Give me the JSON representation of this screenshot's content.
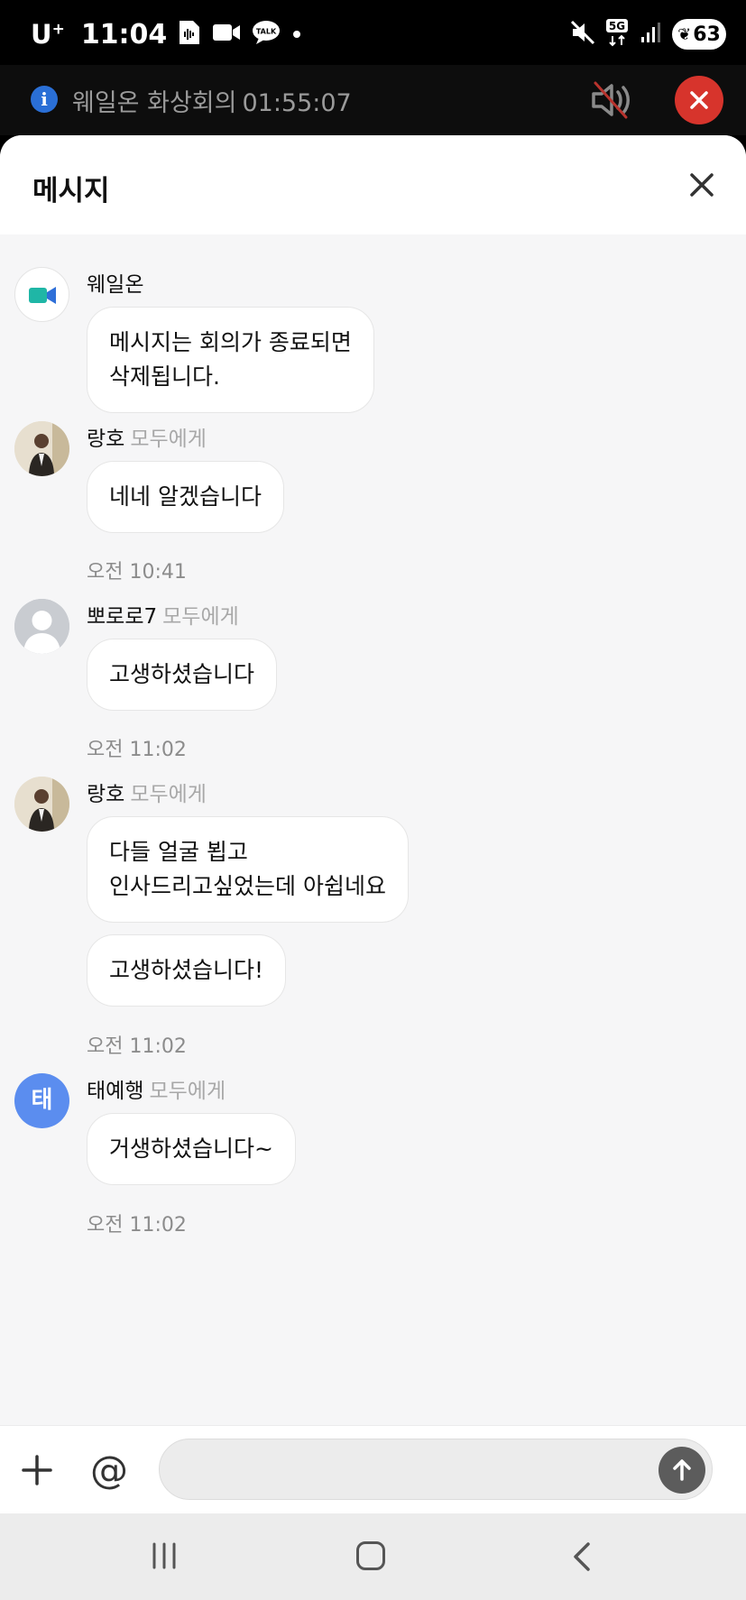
{
  "status_bar": {
    "carrier": "U",
    "carrier_sup": "+",
    "time": "11:04",
    "battery": "63",
    "network": "5G",
    "icons": [
      "notification-doc-icon",
      "video-icon",
      "talk-icon",
      "dot-icon",
      "mute-icon",
      "signal-icon",
      "battery-icon"
    ],
    "talk_label": "TALK"
  },
  "call_bar": {
    "title": "웨일온 화상회의",
    "elapsed": "01:55:07",
    "info_glyph": "i",
    "end_color": "#d7342c"
  },
  "sheet": {
    "title": "메시지"
  },
  "messages": [
    {
      "sender": "웨일온",
      "recipient": "",
      "avatar": "whale-on-camera-icon",
      "lines": [
        "메시지는 회의가 종료되면",
        "삭제됩니다."
      ],
      "time": ""
    },
    {
      "sender": "랑호",
      "recipient": "모두에게",
      "avatar": "photo",
      "lines": [
        "네네 알겠습니다"
      ],
      "time": "오전 10:41"
    },
    {
      "sender": "뽀로로7",
      "recipient": "모두에게",
      "avatar": "default-person-icon",
      "lines": [
        "고생하셨습니다"
      ],
      "time": "오전 11:02"
    },
    {
      "sender": "랑호",
      "recipient": "모두에게",
      "avatar": "photo",
      "lines": [
        "다들 얼굴 뵙고",
        "인사드리고싶었는데 아쉽네요"
      ],
      "lines2": [
        "고생하셨습니다!"
      ],
      "time": "오전 11:02"
    },
    {
      "sender": "태예행",
      "recipient": "모두에게",
      "avatar": "태",
      "avatar_color": "#5b8def",
      "lines": [
        "거생하셨습니다~"
      ],
      "time": "오전 11:02"
    }
  ],
  "composer": {
    "placeholder": "",
    "at_symbol": "@"
  }
}
